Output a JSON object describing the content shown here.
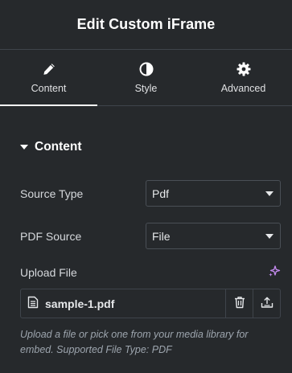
{
  "header": {
    "title": "Edit Custom iFrame"
  },
  "tabs": [
    {
      "label": "Content",
      "icon": "pencil-icon",
      "active": true
    },
    {
      "label": "Style",
      "icon": "contrast-icon",
      "active": false
    },
    {
      "label": "Advanced",
      "icon": "gear-icon",
      "active": false
    }
  ],
  "section": {
    "title": "Content"
  },
  "fields": {
    "source_type": {
      "label": "Source Type",
      "value": "Pdf"
    },
    "pdf_source": {
      "label": "PDF Source",
      "value": "File"
    },
    "upload": {
      "label": "Upload File",
      "file_name": "sample-1.pdf",
      "help": "Upload a file or pick one from your media library for embed. Supported File Type: PDF"
    }
  },
  "colors": {
    "background": "#26292c",
    "border": "#3f444b",
    "ai_accent": "#c58bf0",
    "help_text": "#9da5ae"
  }
}
